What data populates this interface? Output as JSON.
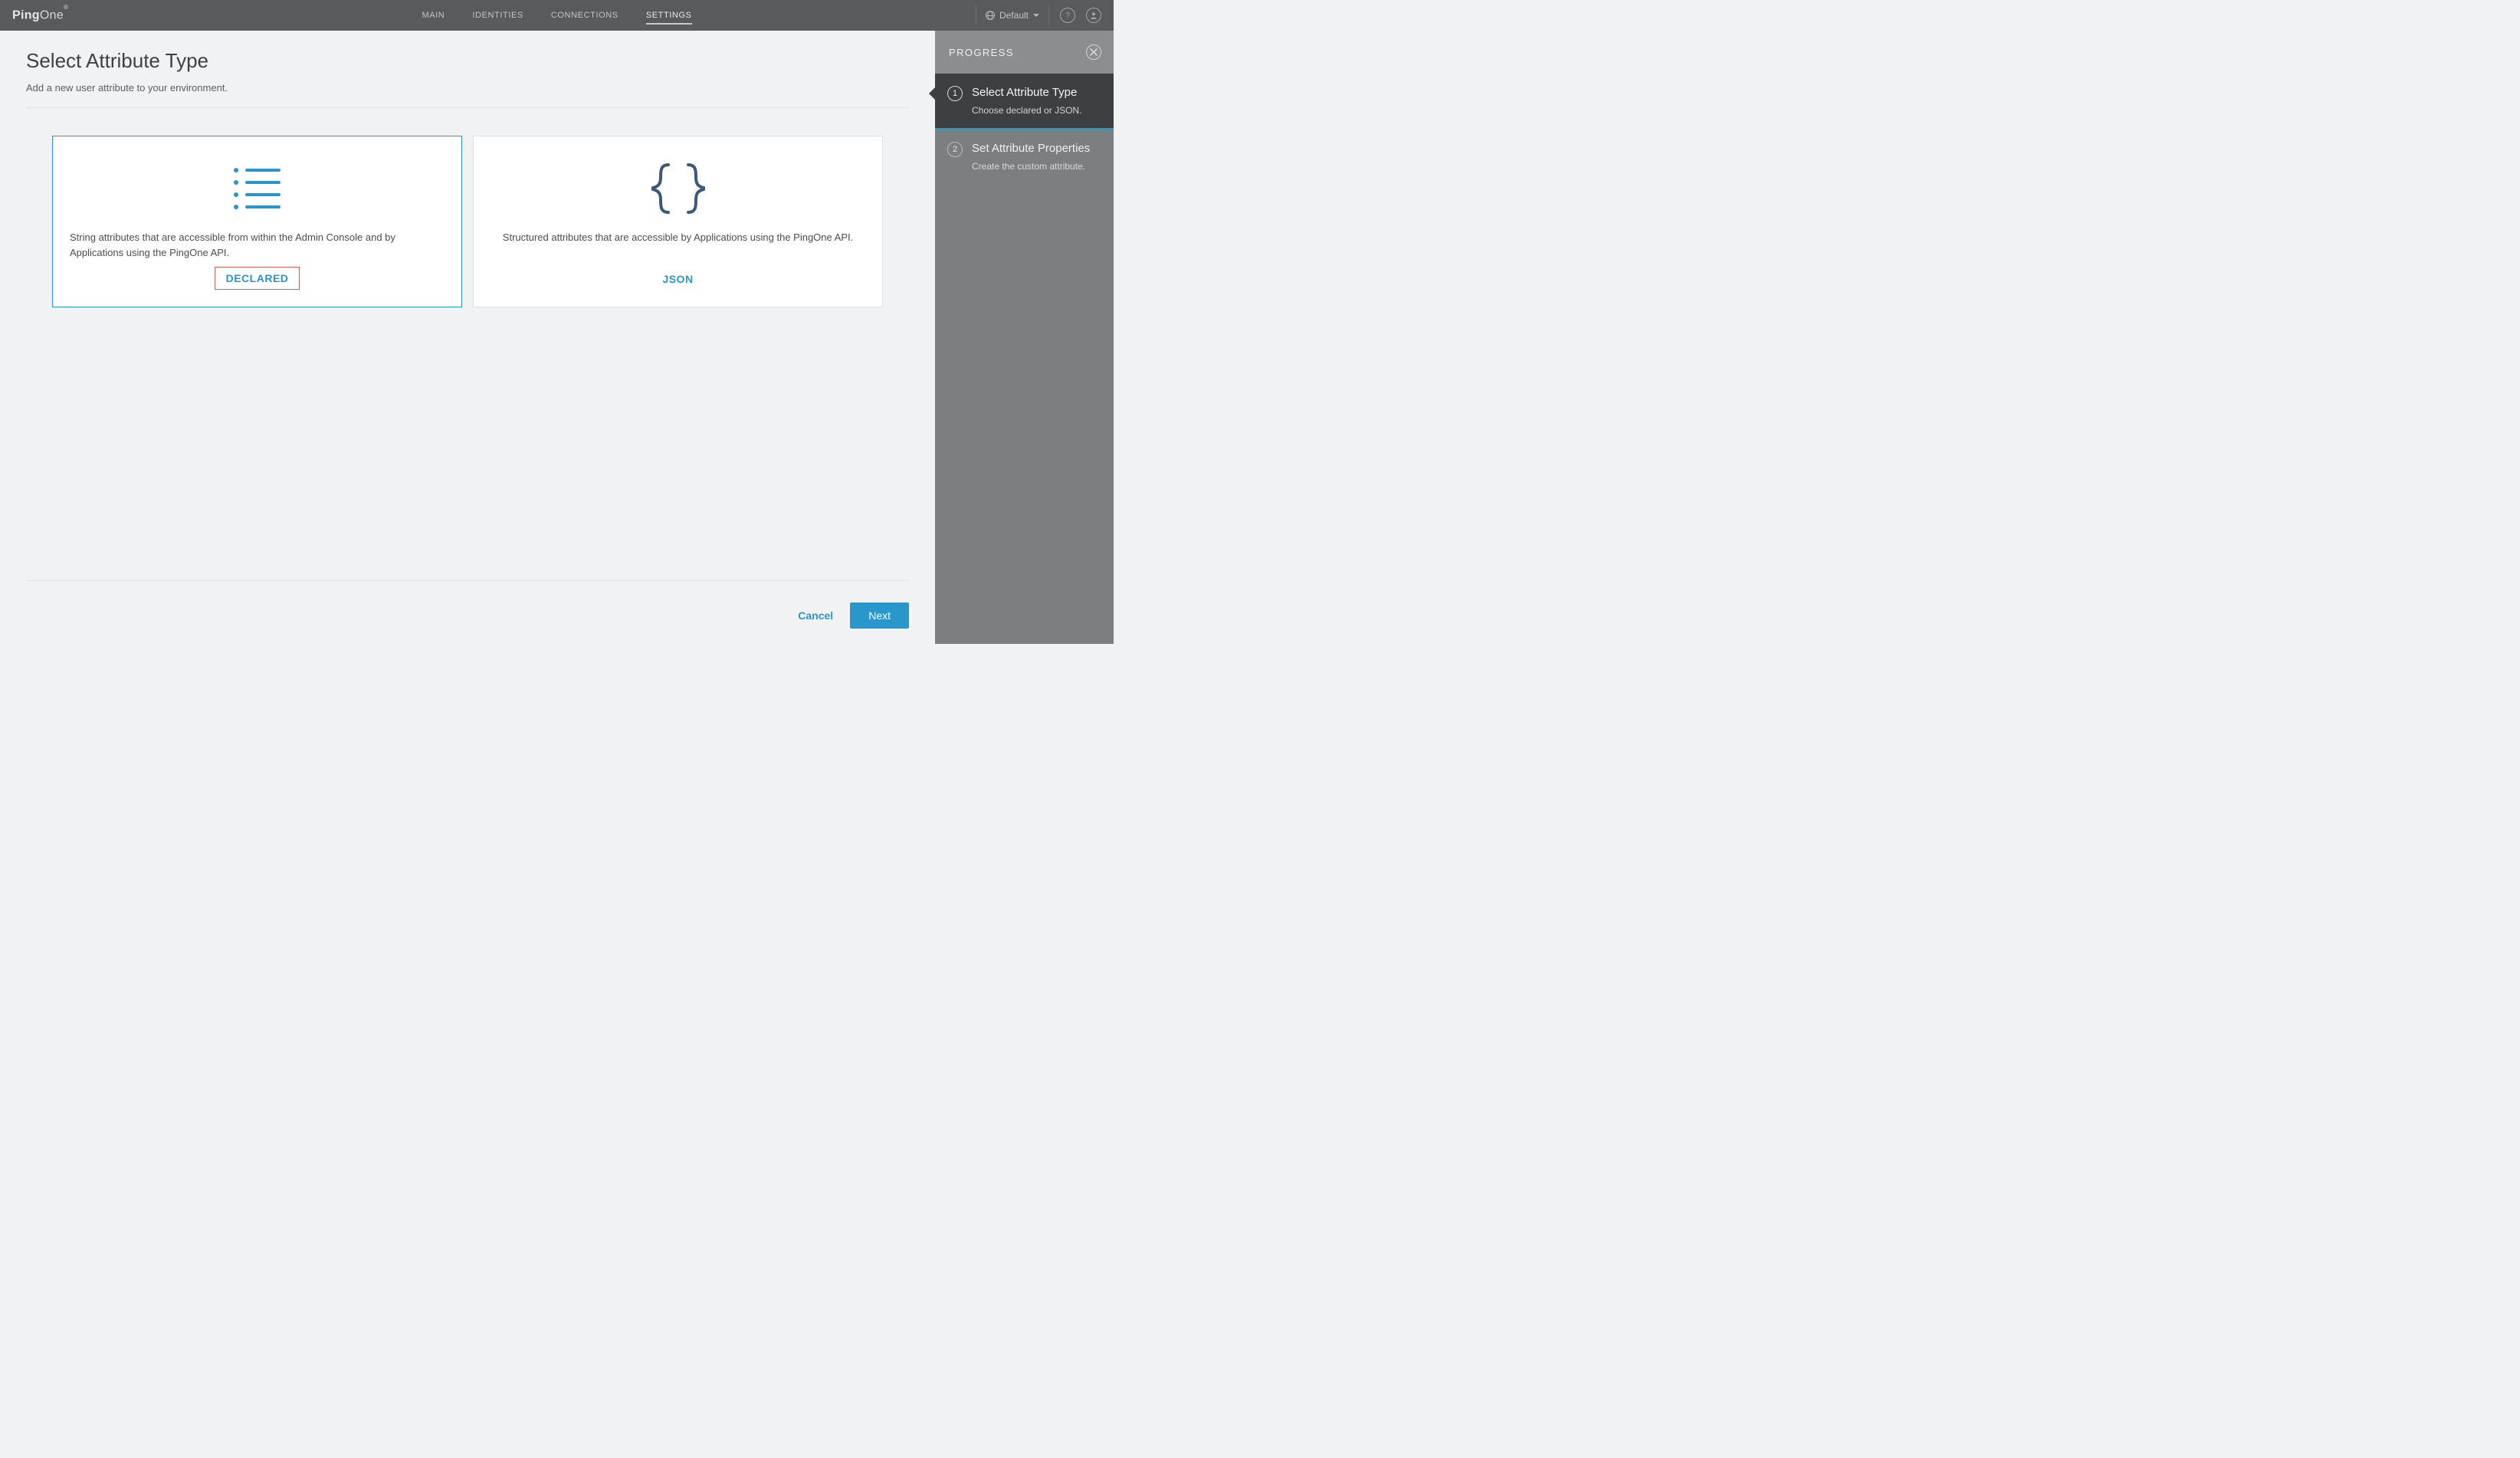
{
  "brand": {
    "strong": "Ping",
    "light": "One"
  },
  "nav": {
    "items": [
      {
        "label": "MAIN"
      },
      {
        "label": "IDENTITIES"
      },
      {
        "label": "CONNECTIONS"
      },
      {
        "label": "SETTINGS"
      }
    ],
    "envLabel": "Default"
  },
  "page": {
    "title": "Select Attribute Type",
    "subtitle": "Add a new user attribute to your environment."
  },
  "cards": {
    "declared": {
      "desc": "String attributes that are accessible from within the Admin Console and by Applications using the PingOne API.",
      "label": "DECLARED"
    },
    "json": {
      "desc": "Structured attributes that are accessible by Applications using the PingOne API.",
      "label": "JSON"
    }
  },
  "footer": {
    "cancel": "Cancel",
    "next": "Next"
  },
  "progress": {
    "title": "PROGRESS",
    "steps": [
      {
        "num": "1",
        "title": "Select Attribute Type",
        "sub": "Choose declared or JSON."
      },
      {
        "num": "2",
        "title": "Set Attribute Properties",
        "sub": "Create the custom attribute."
      }
    ]
  }
}
